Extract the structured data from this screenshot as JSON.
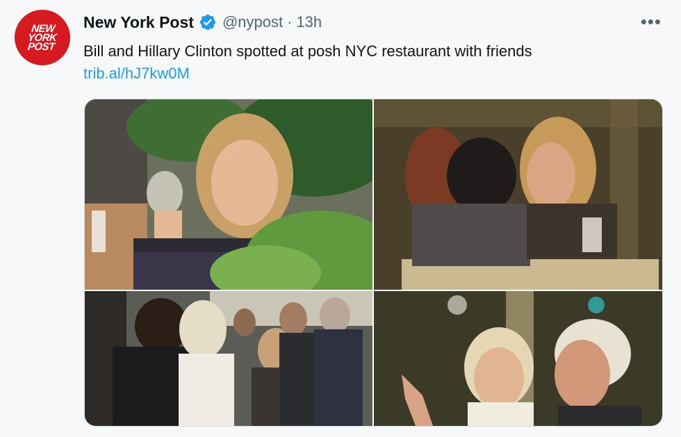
{
  "account": {
    "avatar_text": [
      "NEW",
      "YORK",
      "POST"
    ],
    "display_name": "New York Post",
    "handle": "@nypost",
    "separator": "·",
    "time": "13h",
    "verified": true
  },
  "tweet": {
    "text": "Bill and Hillary Clinton spotted at posh NYC restaurant with friends",
    "link": "trib.al/hJ7kw0M"
  },
  "menu": {
    "more_label": "•••"
  },
  "media": {
    "photo_count": 4,
    "photos": [
      {
        "name": "photo-woman-drinking-wine"
      },
      {
        "name": "photo-couple-at-table"
      },
      {
        "name": "photo-group-greeting"
      },
      {
        "name": "photo-man-and-woman-talking"
      }
    ]
  },
  "colors": {
    "brand_red": "#d71920",
    "link_blue": "#1d9bf0",
    "secondary_text": "#536471",
    "background": "#f7f8f9"
  }
}
